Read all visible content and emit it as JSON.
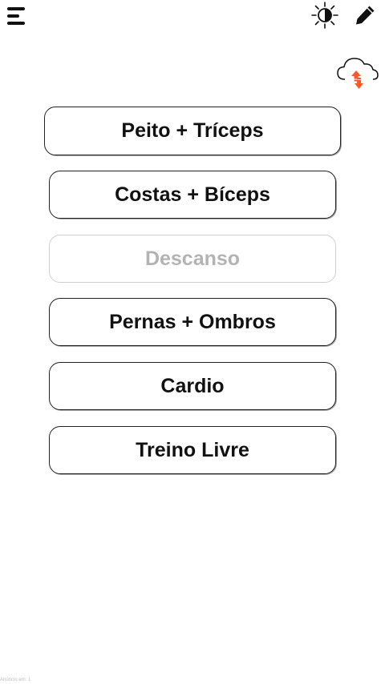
{
  "header": {
    "menu_icon": "hamburger-menu-icon",
    "theme_icon": "brightness-contrast-icon",
    "edit_icon": "pencil-icon",
    "sync_icon": "cloud-sync-icon",
    "accent_color": "#ff5722"
  },
  "workouts": [
    {
      "label": "Peito + Tríceps",
      "enabled": true
    },
    {
      "label": "Costas + Bíceps",
      "enabled": true
    },
    {
      "label": "Descanso",
      "enabled": false
    },
    {
      "label": "Pernas + Ombros",
      "enabled": true
    },
    {
      "label": "Cardio",
      "enabled": true
    },
    {
      "label": "Treino Livre",
      "enabled": true
    }
  ],
  "footer": {
    "ad_text": "Anúncio em: 1"
  }
}
